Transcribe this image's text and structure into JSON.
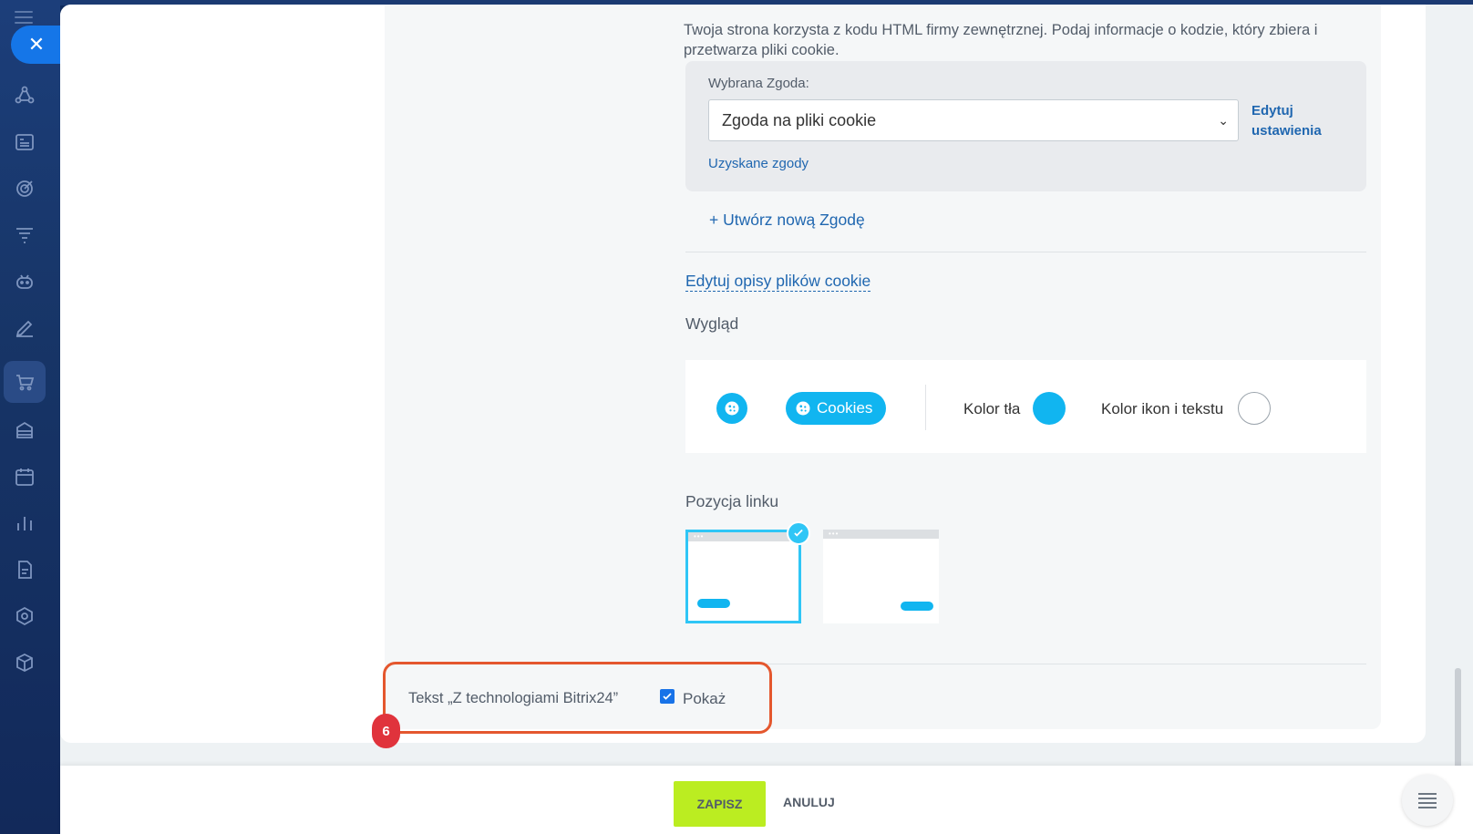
{
  "close_icon_glyph": "✕",
  "cookie_section": {
    "description": "Twoja strona korzysta z kodu HTML firmy zewnętrznej. Podaj informacje o kodzie, który zbiera i przetwarza pliki cookie.",
    "selected_consent_label": "Wybrana Zgoda:",
    "selected_consent_value": "Zgoda na pliki cookie",
    "edit_settings_label": "Edytuj ustawienia",
    "obtained_consents_link": "Uzyskane zgody",
    "create_new_consent_link": "+ Utwórz nową Zgodę",
    "edit_cookie_descriptions_link": "Edytuj opisy plików cookie"
  },
  "appearance": {
    "title": "Wygląd",
    "cookie_pill_label": "Cookies",
    "background_color_label": "Kolor tła",
    "background_color": "#11b5f0",
    "icon_text_color_label": "Kolor ikon i tekstu",
    "icon_text_color": "#ffffff"
  },
  "link_position": {
    "title": "Pozycja linku",
    "options": [
      "left",
      "right"
    ],
    "selected": "left"
  },
  "bitrix_text": {
    "label": "Tekst „Z technologiami Bitrix24”",
    "checkbox_label": "Pokaż",
    "checked": true
  },
  "annotation": {
    "step_number": "6"
  },
  "actions": {
    "save_label": "ZAPISZ",
    "cancel_label": "ANULUJ"
  },
  "colors": {
    "accent_blue": "#11b5f0",
    "link_blue": "#2067b0",
    "save_green": "#bbed21",
    "highlight_red": "#e4572e"
  }
}
